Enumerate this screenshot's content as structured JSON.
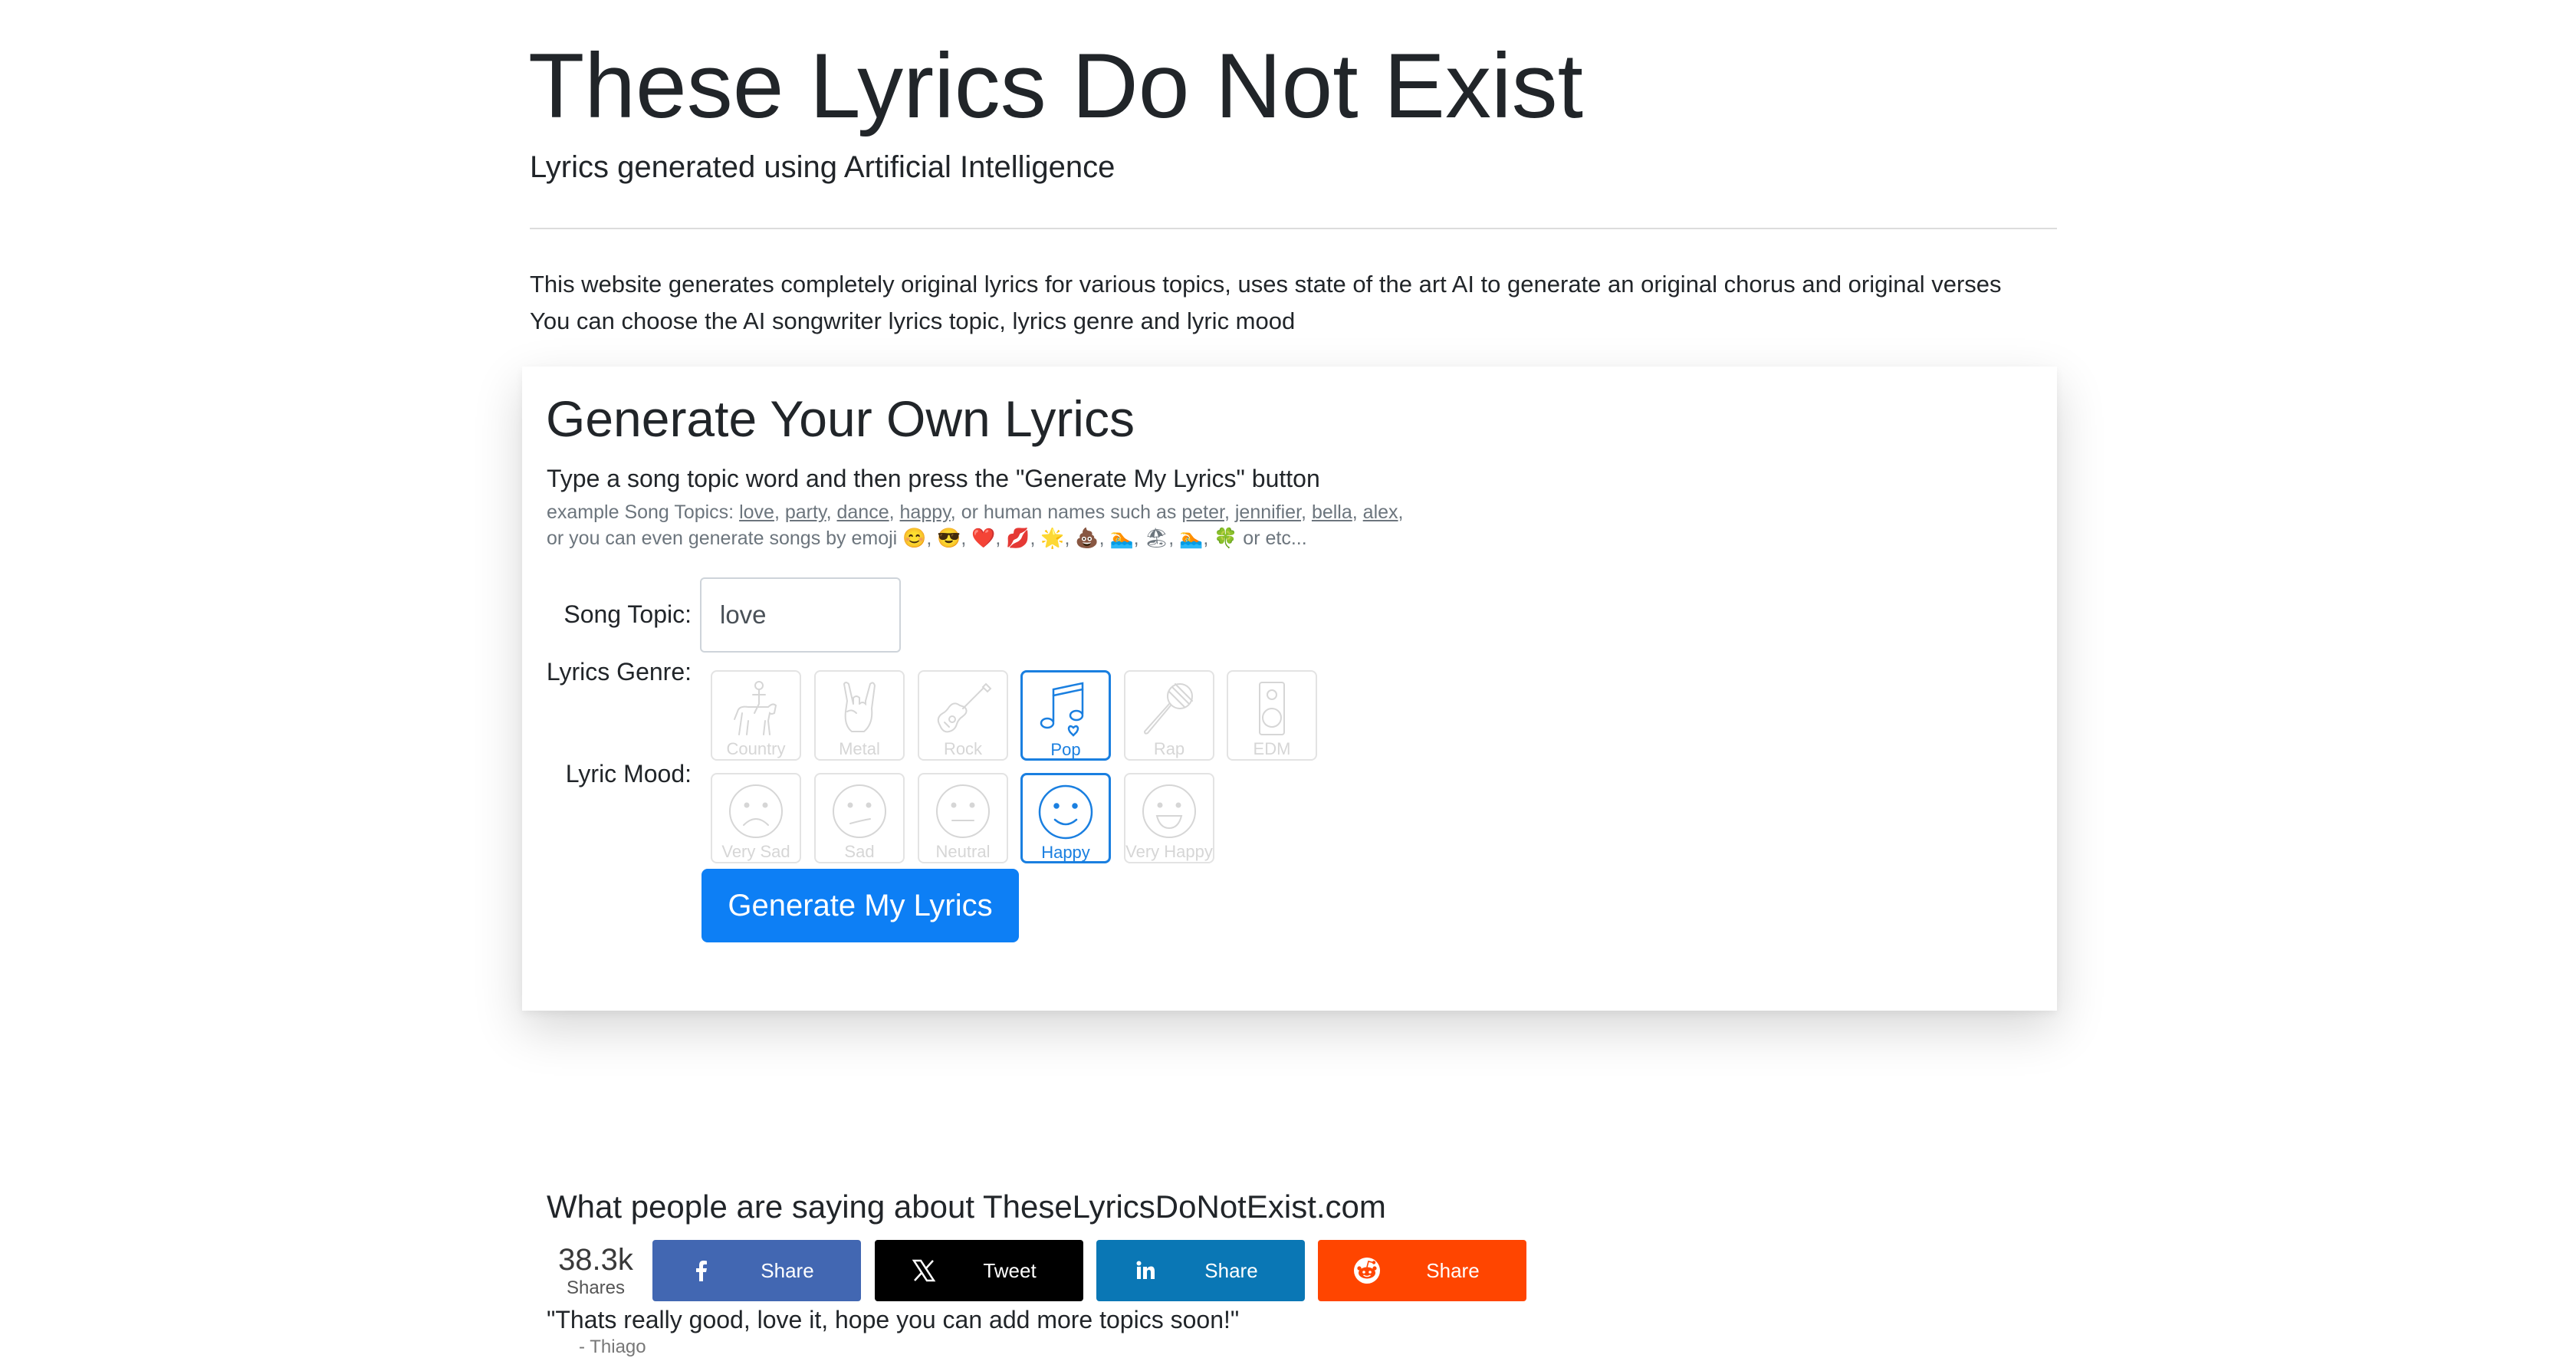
{
  "header": {
    "title": "These Lyrics Do Not Exist",
    "subtitle": "Lyrics generated using Artificial Intelligence",
    "intro_line1": "This website generates completely original lyrics for various topics, uses state of the art AI to generate an original chorus and original verses",
    "intro_line2": "You can choose the AI songwriter lyrics topic, lyrics genre and lyric mood"
  },
  "generator": {
    "title": "Generate Your Own Lyrics",
    "instruction": "Type a song topic word and then press the \"Generate My Lyrics\" button",
    "examples": {
      "prefix": "example Song Topics: ",
      "topics": [
        "love",
        "party",
        "dance",
        "happy"
      ],
      "names_text": ", or human names such as ",
      "names": [
        "peter",
        "jennifier",
        "bella",
        "alex"
      ],
      "emoji_prefix": "or you can even generate songs by emoji ",
      "emojis": [
        "😊",
        "😎",
        "❤️",
        "💋",
        "🌟",
        "💩",
        "🏊",
        "🏖",
        "🏊",
        "🍀"
      ],
      "suffix": " or etc..."
    },
    "topic_label": "Song Topic:",
    "topic_value": "love",
    "genre_label": "Lyrics Genre:",
    "genres": [
      {
        "label": "Country",
        "icon": "horse-rider-icon",
        "selected": false
      },
      {
        "label": "Metal",
        "icon": "rock-hand-icon",
        "selected": false
      },
      {
        "label": "Rock",
        "icon": "guitar-icon",
        "selected": false
      },
      {
        "label": "Pop",
        "icon": "music-notes-icon",
        "selected": true
      },
      {
        "label": "Rap",
        "icon": "microphone-icon",
        "selected": false
      },
      {
        "label": "EDM",
        "icon": "speaker-icon",
        "selected": false
      }
    ],
    "mood_label": "Lyric Mood:",
    "moods": [
      {
        "label": "Very Sad",
        "icon": "very-sad-face-icon",
        "selected": false
      },
      {
        "label": "Sad",
        "icon": "sad-face-icon",
        "selected": false
      },
      {
        "label": "Neutral",
        "icon": "neutral-face-icon",
        "selected": false
      },
      {
        "label": "Happy",
        "icon": "happy-face-icon",
        "selected": true
      },
      {
        "label": "Very Happy",
        "icon": "very-happy-face-icon",
        "selected": false
      }
    ],
    "button_label": "Generate My Lyrics"
  },
  "social": {
    "heading": "What people are saying about TheseLyricsDoNotExist.com",
    "share_count": "38.3k",
    "share_count_label": "Shares",
    "buttons": [
      {
        "network": "facebook",
        "label": "Share",
        "color": "#4267b2",
        "icon": "facebook-icon"
      },
      {
        "network": "x",
        "label": "Tweet",
        "color": "#000000",
        "icon": "x-icon"
      },
      {
        "network": "linkedin",
        "label": "Share",
        "color": "#0a77b5",
        "icon": "linkedin-icon"
      },
      {
        "network": "reddit",
        "label": "Share",
        "color": "#ff4500",
        "icon": "reddit-icon"
      }
    ],
    "quote": "\"Thats really good, love it, hope you can add more topics soon!\"",
    "author": "- Thiago"
  },
  "colors": {
    "accent": "#0d7ff5",
    "selected_border": "#1a7fe0",
    "inactive_icon": "#d6d6d6"
  }
}
